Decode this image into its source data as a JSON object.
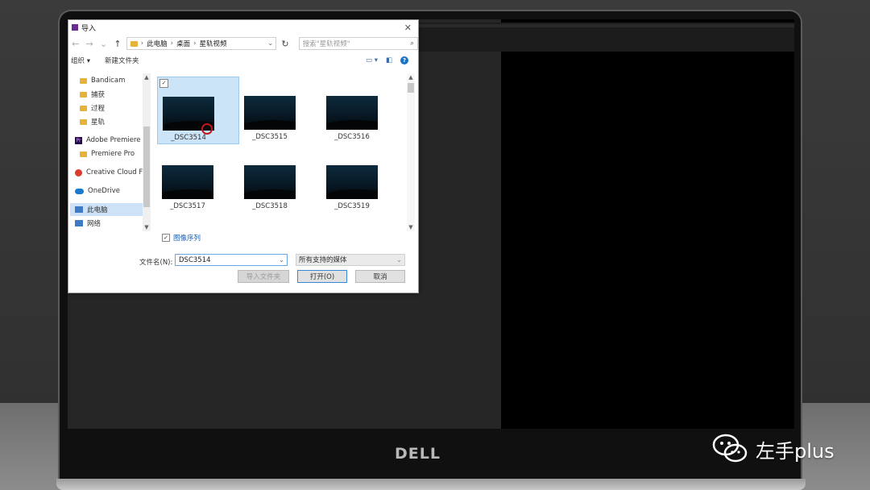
{
  "dialog": {
    "title": "导入",
    "address": {
      "crumbs": [
        "此电脑",
        "桌面",
        "星轨视频"
      ],
      "separator": "›"
    },
    "search": {
      "placeholder": "搜索\"星轨视频\""
    },
    "toolbar": {
      "organize": "组织 ▾",
      "new_folder": "新建文件夹"
    },
    "nav": {
      "items": [
        "Bandicam",
        "捕获",
        "过程",
        "星轨",
        "Adobe Premiere",
        "Premiere Pro",
        "Creative Cloud F",
        "OneDrive",
        "此电脑",
        "网络"
      ]
    },
    "files": [
      "_DSC3514",
      "_DSC3515",
      "_DSC3516",
      "_DSC3517",
      "_DSC3518",
      "_DSC3519"
    ],
    "image_sequence": {
      "label": "图像序列",
      "checked": true
    },
    "filename": {
      "label": "文件名(N):",
      "value": "DSC3514"
    },
    "filetype": {
      "value": "所有支持的媒体"
    },
    "buttons": {
      "import_folder": "导入文件夹",
      "open": "打开(O)",
      "cancel": "取消"
    }
  },
  "laptop": {
    "brand": "DELL"
  },
  "watermark": {
    "text": "左手plus"
  }
}
